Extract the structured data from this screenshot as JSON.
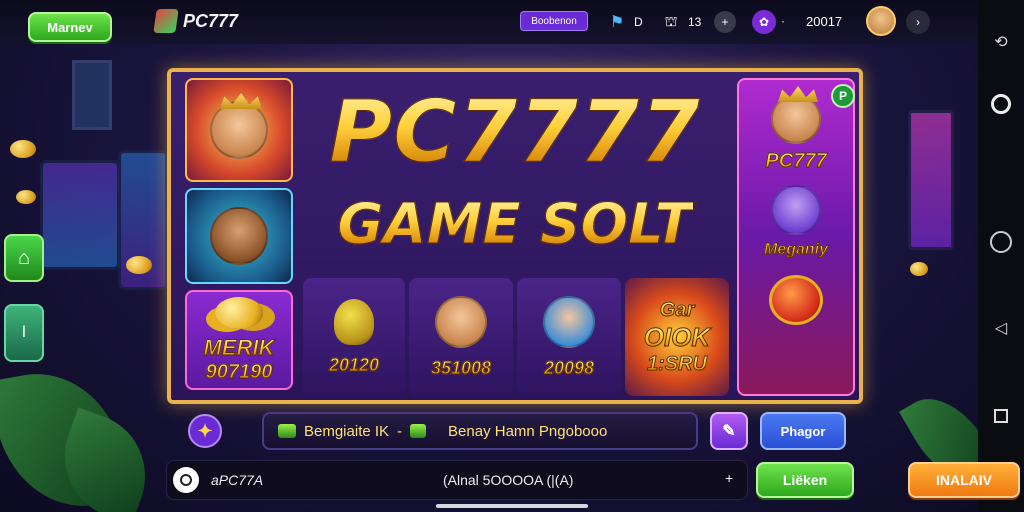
{
  "topbar": {
    "menu_label": "Marnev",
    "logo_text": "PC777",
    "badge_label": "Boobenon",
    "stat1": "D",
    "stat2": "13",
    "stat3": "20017"
  },
  "machine": {
    "title_line1": "PC7777",
    "title_line2": "GAME SOLT",
    "left_panel_word": "MERIK",
    "left_panel_number": "907190",
    "reel_values": [
      "20120",
      "351008",
      "20098"
    ],
    "feature_line1": "Gar",
    "feature_line2": "OIOK",
    "feature_line3": "1:SRU",
    "right_logo": "PC777",
    "right_banner": "Meganiy",
    "corner_badge": "P"
  },
  "bottom": {
    "ticker_left": "Bemgiaite IK",
    "ticker_sep": "-",
    "ticker_right": "Benay Hamn Pngobooo",
    "action_button": "Phagor",
    "account_label": "aPC77A",
    "balance_text": "(Alnal 5OOOOA (|(A)",
    "balance_plus": "+",
    "green_button": "Liëken",
    "orange_button": "INALAIV"
  },
  "colors": {
    "gold_frame": "#e7b34a",
    "green_button": "#2ea81e",
    "orange_button": "#f07a12",
    "blue_button": "#2a4fd6",
    "purple_badge": "#6a2ad6"
  }
}
